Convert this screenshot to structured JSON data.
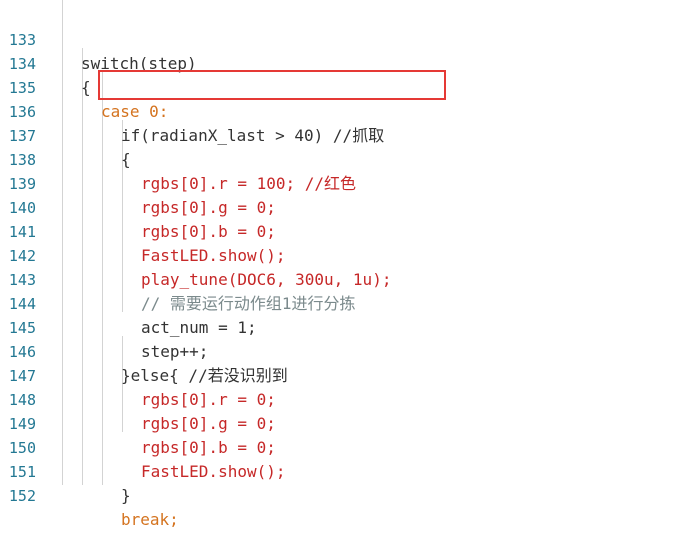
{
  "editor": {
    "lines": [
      {
        "num": "133",
        "text": "switch(step)"
      },
      {
        "num": "134",
        "text": "{"
      },
      {
        "num": "135",
        "text": "case 0:"
      },
      {
        "num": "136",
        "text": "if(radianX_last > 40) //抓取"
      },
      {
        "num": "137",
        "text": "{"
      },
      {
        "num": "138",
        "text": "rgbs[0].r = 100; //红色"
      },
      {
        "num": "139",
        "text": "rgbs[0].g = 0;"
      },
      {
        "num": "140",
        "text": "rgbs[0].b = 0;"
      },
      {
        "num": "141",
        "text": "FastLED.show();"
      },
      {
        "num": "142",
        "text": "play_tune(DOC6, 300u, 1u);"
      },
      {
        "num": "143",
        "text": "// 需要运行动作组1进行分拣"
      },
      {
        "num": "144",
        "text": "act_num = 1;"
      },
      {
        "num": "145",
        "text": "step++;"
      },
      {
        "num": "146",
        "text": "}else{ //若没识别到"
      },
      {
        "num": "147",
        "text": "rgbs[0].r = 0;"
      },
      {
        "num": "148",
        "text": "rgbs[0].g = 0;"
      },
      {
        "num": "149",
        "text": "rgbs[0].b = 0;"
      },
      {
        "num": "150",
        "text": "FastLED.show();"
      },
      {
        "num": "151",
        "text": "}"
      },
      {
        "num": "152",
        "text": "break;"
      }
    ]
  },
  "highlight": {
    "color": "#e53935",
    "line": "136"
  }
}
